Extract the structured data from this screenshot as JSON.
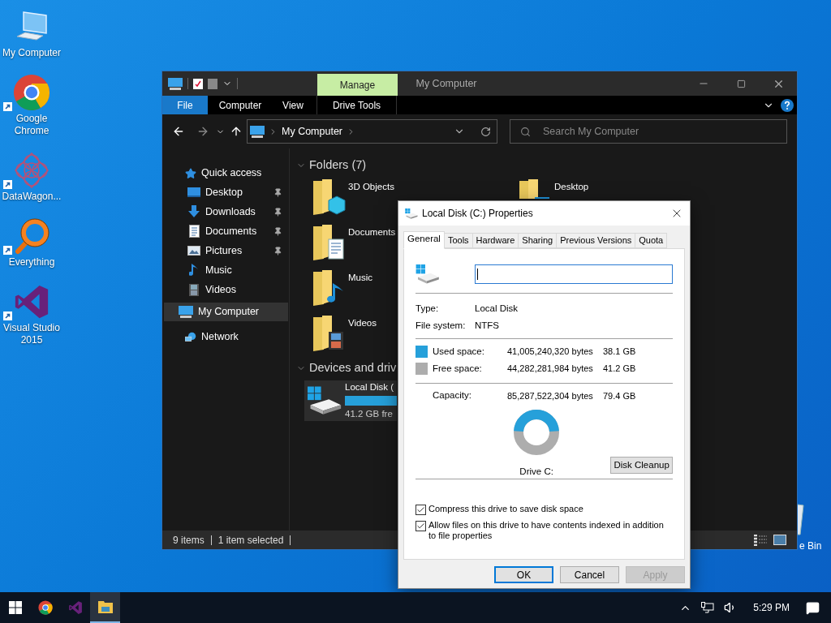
{
  "desktop": {
    "icons": [
      {
        "kind": "computer",
        "label": "My Computer",
        "shortcut": false
      },
      {
        "kind": "chrome",
        "label": "Google Chrome",
        "shortcut": true
      },
      {
        "kind": "datawagon",
        "label": "DataWagon...",
        "shortcut": true
      },
      {
        "kind": "everything",
        "label": "Everything",
        "shortcut": true
      },
      {
        "kind": "vs",
        "label": "Visual Studio 2015",
        "shortcut": true
      }
    ],
    "recycle_bin": {
      "label": "e Bin"
    }
  },
  "explorer": {
    "title": "My Computer",
    "context_tab": "Manage",
    "file_tab": "File",
    "ribbon_tabs": [
      {
        "label": "Computer",
        "kind": "tab"
      },
      {
        "label": "View",
        "kind": "tab"
      },
      {
        "label": "Drive Tools",
        "kind": "context"
      }
    ],
    "address": {
      "path": "My Computer"
    },
    "search": {
      "placeholder": "Search My Computer"
    },
    "nav": [
      {
        "label": "Quick access",
        "kind": "star",
        "selected": false,
        "children": [
          {
            "label": "Desktop",
            "kind": "desktop",
            "pinned": true,
            "selected": false
          },
          {
            "label": "Downloads",
            "kind": "downloads",
            "pinned": true,
            "selected": false
          },
          {
            "label": "Documents",
            "kind": "documents",
            "pinned": true,
            "selected": false
          },
          {
            "label": "Pictures",
            "kind": "pictures",
            "pinned": true,
            "selected": false
          },
          {
            "label": "Music",
            "kind": "music",
            "pinned": false,
            "selected": false
          },
          {
            "label": "Videos",
            "kind": "videos",
            "pinned": false,
            "selected": false
          }
        ]
      },
      {
        "label": "My Computer",
        "kind": "computer",
        "selected": true
      },
      {
        "label": "Network",
        "kind": "network",
        "selected": false
      }
    ],
    "groups": [
      {
        "kind": "folders",
        "title": "Folders (7)",
        "expanded": true,
        "columns": [
          [
            {
              "label": "3D Objects",
              "kind": "cube"
            },
            {
              "label": "Documents",
              "kind": "documents"
            },
            {
              "label": "Music",
              "kind": "music"
            },
            {
              "label": "Videos",
              "kind": "videos"
            }
          ],
          [
            {
              "label": "Desktop",
              "kind": "desktop"
            }
          ]
        ]
      },
      {
        "kind": "drives",
        "title": "Devices and driv",
        "expanded": true,
        "drives": [
          {
            "label": "Local Disk (",
            "free": "41.2 GB fre",
            "selected": true
          }
        ]
      }
    ],
    "status": {
      "count": "9 items",
      "selection": "1 item selected"
    }
  },
  "dialog": {
    "title": "Local Disk (C:) Properties",
    "tabs": [
      {
        "label": "General",
        "selected": true
      },
      {
        "label": "Tools",
        "selected": false
      },
      {
        "label": "Hardware",
        "selected": false
      },
      {
        "label": "Sharing",
        "selected": false
      },
      {
        "label": "Previous Versions",
        "selected": false
      },
      {
        "label": "Quota",
        "selected": false
      }
    ],
    "type": {
      "label": "Type:",
      "value": "Local Disk"
    },
    "file_system": {
      "label": "File system:",
      "value": "NTFS"
    },
    "space": [
      {
        "label": "Used space:",
        "bytes": "41,005,240,320 bytes",
        "size": "38.1 GB",
        "color": "#26a0da"
      },
      {
        "label": "Free space:",
        "bytes": "44,282,281,984 bytes",
        "size": "41.2 GB",
        "color": "#adadad"
      }
    ],
    "capacity": {
      "label": "Capacity:",
      "bytes": "85,287,522,304 bytes",
      "size": "79.4 GB"
    },
    "drive_chart": {
      "label": "Drive C:"
    },
    "cleanup_button": "Disk Cleanup",
    "options": [
      {
        "label": "Compress this drive to save disk space",
        "checked": true
      },
      {
        "label": "Allow files on this drive to have contents indexed in addition to file properties",
        "checked": true
      }
    ],
    "buttons": [
      {
        "label": "OK",
        "kind": "default"
      },
      {
        "label": "Cancel",
        "kind": "normal"
      },
      {
        "label": "Apply",
        "kind": "disabled"
      }
    ]
  },
  "taskbar": {
    "apps": [
      {
        "kind": "start",
        "active": false
      },
      {
        "kind": "chrome",
        "active": false
      },
      {
        "kind": "vs",
        "active": false
      },
      {
        "kind": "explorer",
        "active": true
      }
    ],
    "time": "5:29 PM"
  }
}
